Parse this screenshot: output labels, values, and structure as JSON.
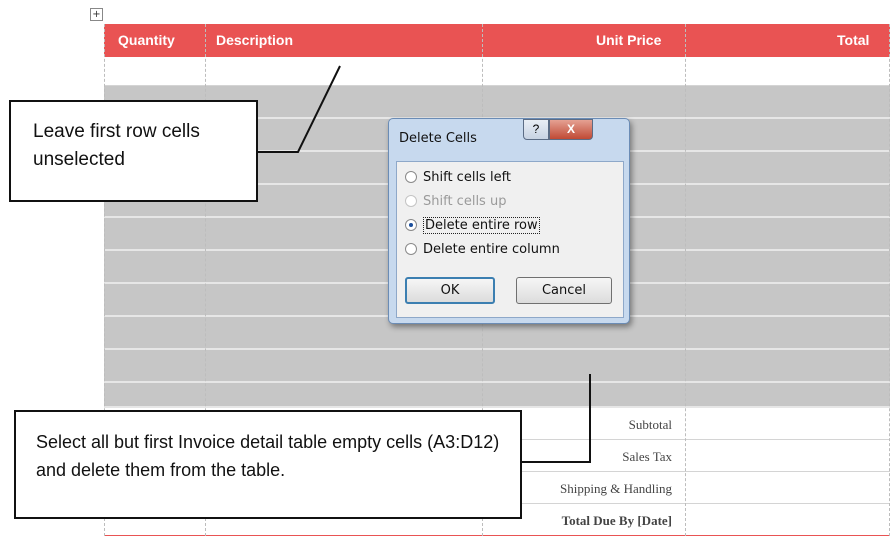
{
  "table": {
    "headers": [
      "Quantity",
      "Description",
      "Unit Price",
      "Total"
    ],
    "summary_labels": [
      "Subtotal",
      "Sales Tax",
      "Shipping & Handling",
      "Total Due By [Date]"
    ]
  },
  "dialog": {
    "title": "Delete Cells",
    "help_glyph": "?",
    "close_glyph": "X",
    "options": [
      {
        "label": "Shift cells left",
        "selected": false,
        "enabled": true
      },
      {
        "label": "Shift cells up",
        "selected": false,
        "enabled": false
      },
      {
        "label": "Delete entire row",
        "selected": true,
        "enabled": true
      },
      {
        "label": "Delete entire column",
        "selected": false,
        "enabled": true
      }
    ],
    "ok_label": "OK",
    "cancel_label": "Cancel"
  },
  "callouts": {
    "top": "Leave first row cells unselected",
    "bottom": "Select all but first Invoice detail table empty cells (A3:D12) and delete them from the table."
  },
  "colors": {
    "header_bg": "#e95353",
    "selection_bg": "#c6c6c6"
  }
}
